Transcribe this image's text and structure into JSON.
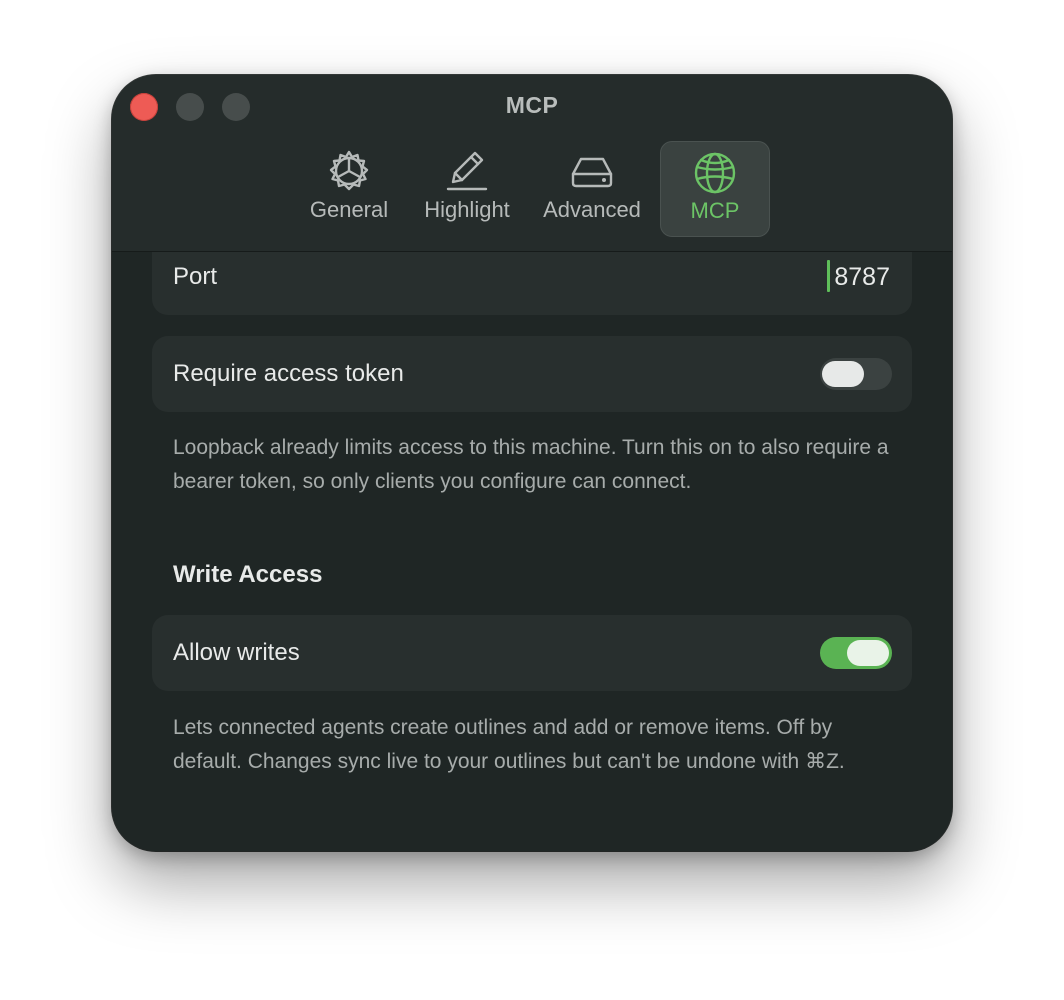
{
  "window": {
    "title": "MCP"
  },
  "tabs": [
    {
      "label": "General",
      "icon": "gear-icon"
    },
    {
      "label": "Highlight",
      "icon": "pencil-icon"
    },
    {
      "label": "Advanced",
      "icon": "drive-icon"
    },
    {
      "label": "MCP",
      "icon": "globe-icon",
      "selected": true
    }
  ],
  "port": {
    "label": "Port",
    "value": "8787"
  },
  "token": {
    "label": "Require access token",
    "enabled": false,
    "description": "Loopback already limits access to this machine. Turn this on to also require a bearer token, so only clients you configure can connect."
  },
  "write_access": {
    "heading": "Write Access",
    "allow_label": "Allow writes",
    "enabled": true,
    "description": "Lets connected agents create outlines and add or remove items. Off by default. Changes sync live to your outlines but can't be undone with ⌘Z."
  },
  "colors": {
    "accent": "#5ab353",
    "accent_text": "#6cc466",
    "window_bg": "#1f2625",
    "card_bg": "#282f2e",
    "close_button": "#ee5b55"
  }
}
